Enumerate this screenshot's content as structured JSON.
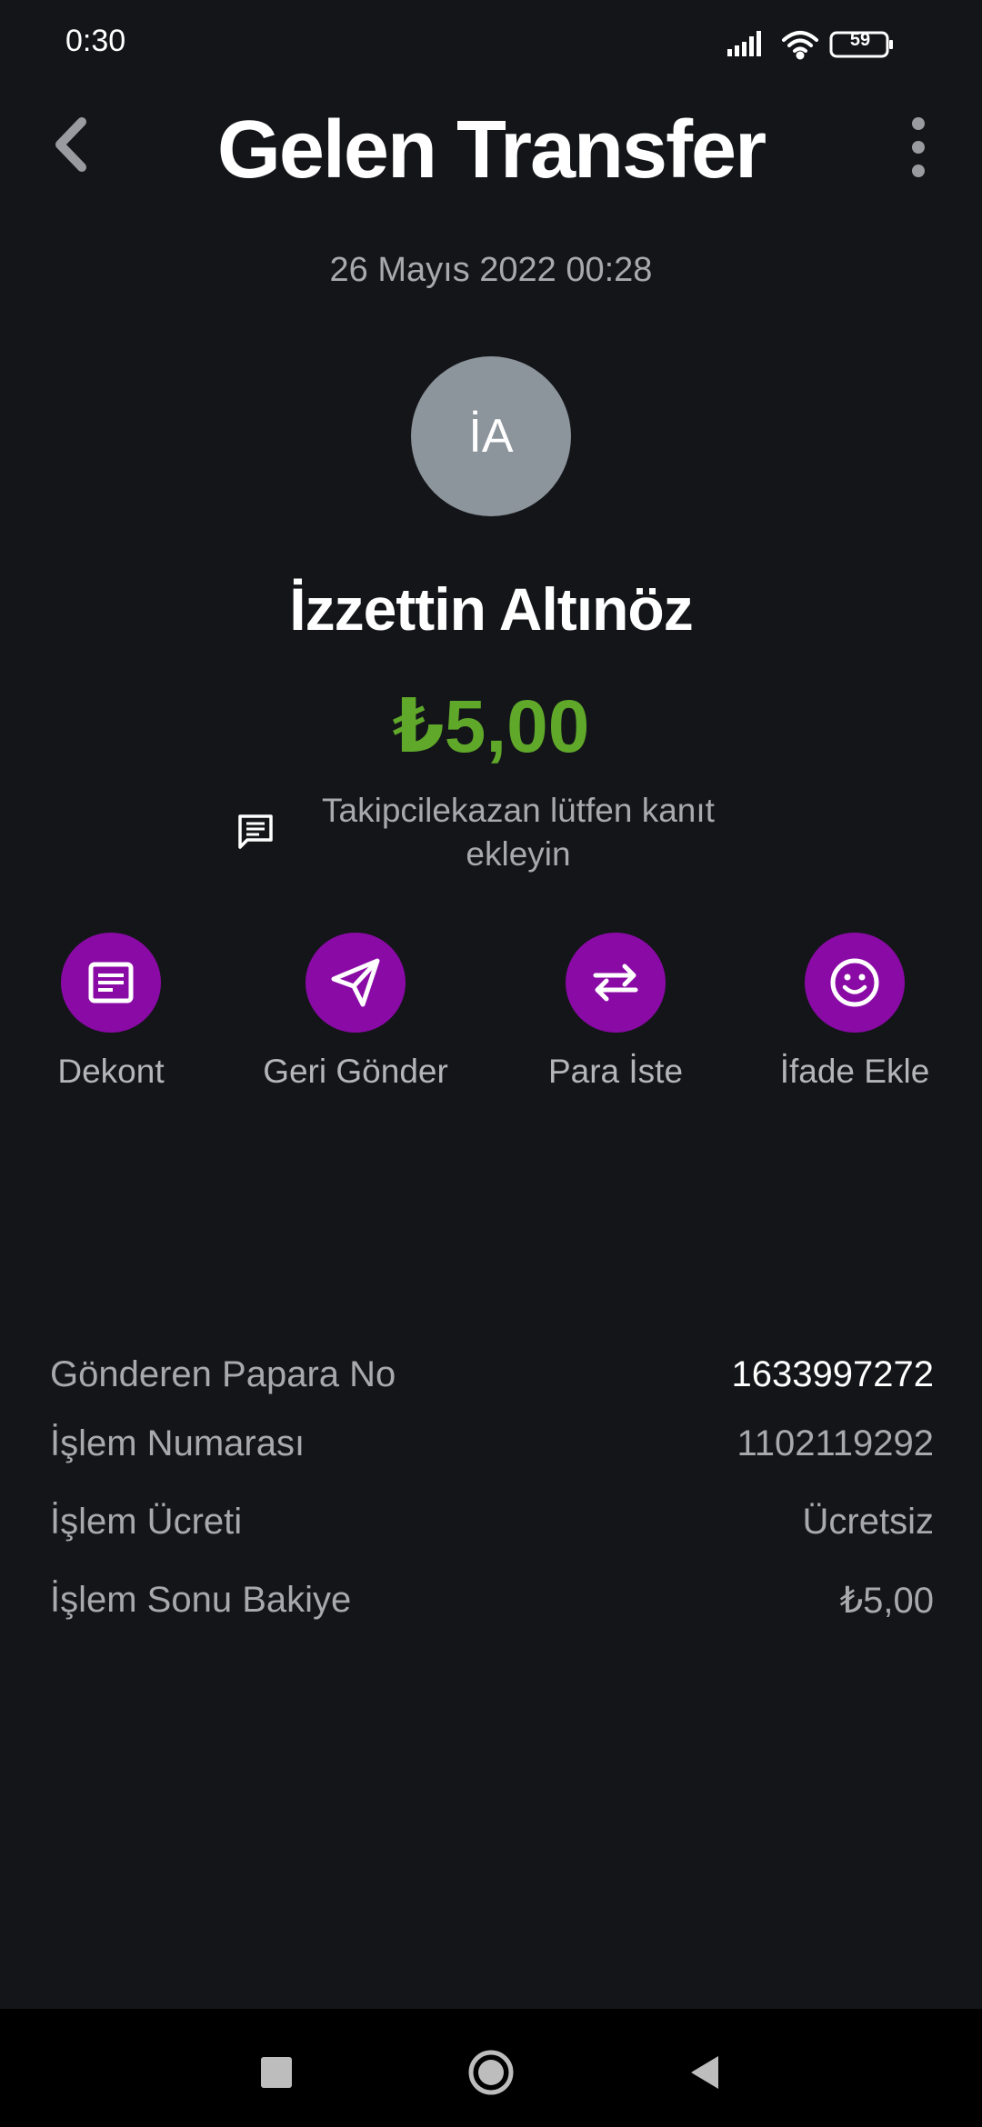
{
  "status_bar": {
    "time": "0:30",
    "battery": "59"
  },
  "header": {
    "title": "Gelen Transfer"
  },
  "transfer": {
    "date": "26 Mayıs 2022 00:28",
    "avatar_initials": "İA",
    "sender_name": "İzzettin Altınöz",
    "amount": "₺5,00",
    "note": "Takipcilekazan lütfen kanıt ekleyin"
  },
  "actions": [
    {
      "label": "Dekont",
      "icon": "receipt-icon"
    },
    {
      "label": "Geri Gönder",
      "icon": "send-icon"
    },
    {
      "label": "Para İste",
      "icon": "swap-arrows-icon"
    },
    {
      "label": "İfade Ekle",
      "icon": "smiley-icon"
    }
  ],
  "details": [
    {
      "label": "Gönderen Papara No",
      "value": "1633997272"
    },
    {
      "label": "İşlem Numarası",
      "value": "1102119292"
    },
    {
      "label": "İşlem Ücreti",
      "value": "Ücretsiz"
    },
    {
      "label": "İşlem Sonu Bakiye",
      "value": "₺5,00"
    }
  ],
  "colors": {
    "background": "#141519",
    "accent": "#8a0aa6",
    "amount_green": "#5fa82a",
    "muted_text": "#a8a9ad"
  }
}
